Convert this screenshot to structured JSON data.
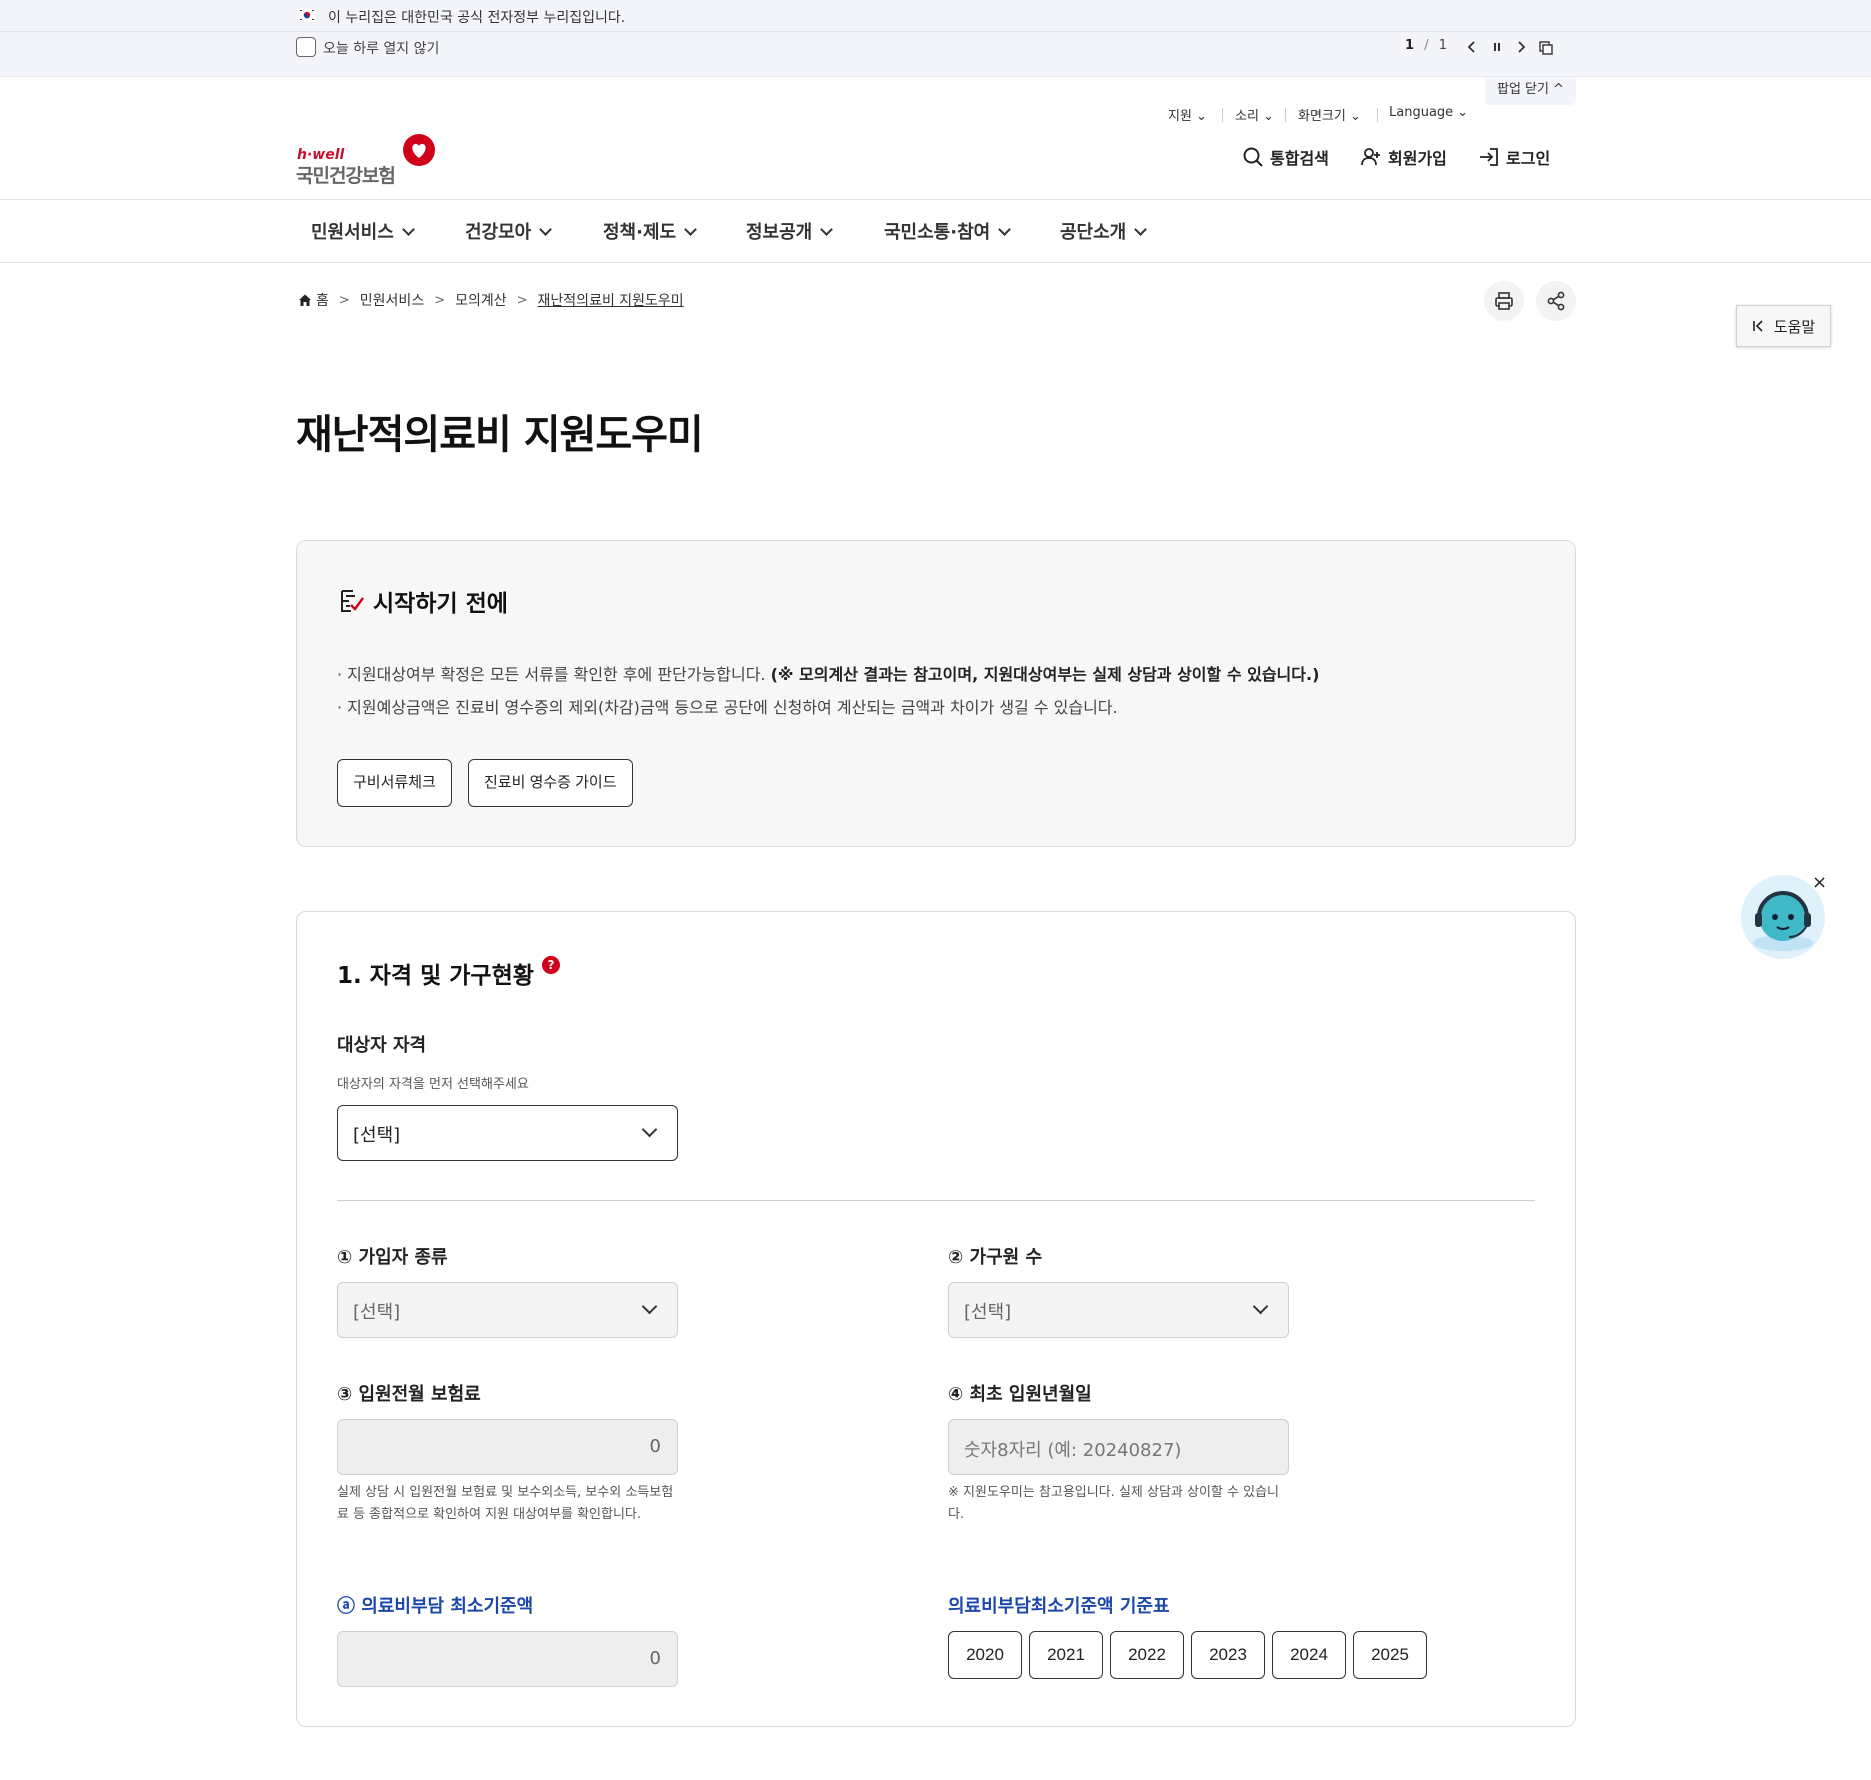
{
  "gov_banner": {
    "text": "이 누리집은 대한민국 공식 전자정부 누리집입니다."
  },
  "popup_bar": {
    "checkbox_label": "오늘 하루 열지 않기",
    "pager_current": "1",
    "pager_sep": "/",
    "pager_total": "1",
    "close_label": "팝업 닫기 ^"
  },
  "utility_menu": {
    "items": [
      "지원 ⌄",
      "소리 ⌄",
      "화면크기 ⌄",
      "Language ⌄"
    ]
  },
  "logo": {
    "brand_en": "h·well",
    "brand_ko": "국민건강보험"
  },
  "header_links": {
    "search": "통합검색",
    "signup": "회원가입",
    "login": "로그인"
  },
  "gnb": {
    "items": [
      "민원서비스",
      "건강모아",
      "정책·제도",
      "정보공개",
      "국민소통·참여",
      "공단소개"
    ]
  },
  "breadcrumb": {
    "home": "홈",
    "level1": "민원서비스",
    "level2": "모의계산",
    "current": "재난적의료비 지원도우미"
  },
  "help_button": {
    "label": "도움말"
  },
  "page_title": "재난적의료비 지원도우미",
  "before_start": {
    "title": "시작하기 전에",
    "item1_text": "지원대상여부 확정은 모든 서류를 확인한 후에 판단가능합니다.",
    "item1_bold": "(※ 모의계산 결과는 참고이며, 지원대상여부는 실제 상담과 상이할 수 있습니다.)",
    "item2_text": "지원예상금액은 진료비 영수증의 제외(차감)금액 등으로 공단에 신청하여 계산되는 금액과 차이가 생길 수 있습니다.",
    "btn_documents": "구비서류체크",
    "btn_receipt_guide": "진료비 영수증 가이드"
  },
  "section1": {
    "title": "1. 자격 및 가구현황",
    "help_icon": "?",
    "qualification_label": "대상자 자격",
    "qualification_hint": "대상자의 자격을 먼저 선택해주세요",
    "qualification_value": "[선택]",
    "subscriber_type_label": "① 가입자 종류",
    "subscriber_type_value": "[선택]",
    "household_label": "② 가구원 수",
    "household_value": "[선택]",
    "premium_label": "③ 입원전월 보험료",
    "premium_value": "0",
    "premium_note": "실제 상담 시 입원전월 보험료 및 보수외소득, 보수외 소득보험료 등 종합적으로 확인하여 지원 대상여부를 확인합니다.",
    "admission_date_label": "④ 최초 입원년월일",
    "admission_date_placeholder": "숫자8자리 (예: 20240827)",
    "admission_date_note": "※ 지원도우미는 참고용입니다. 실제 상담과 상이할 수 있습니다.",
    "min_cost_label": "ⓐ 의료비부담 최소기준액",
    "min_cost_value": "0",
    "min_cost_table_label": "의료비부담최소기준액 기준표",
    "years": [
      "2020",
      "2021",
      "2022",
      "2023",
      "2024",
      "2025"
    ]
  },
  "chatbot": {
    "close": "×"
  },
  "colors": {
    "accent_red": "#d0021b",
    "link_blue": "#1a47a8",
    "banner_bg": "#f3f5fa"
  }
}
